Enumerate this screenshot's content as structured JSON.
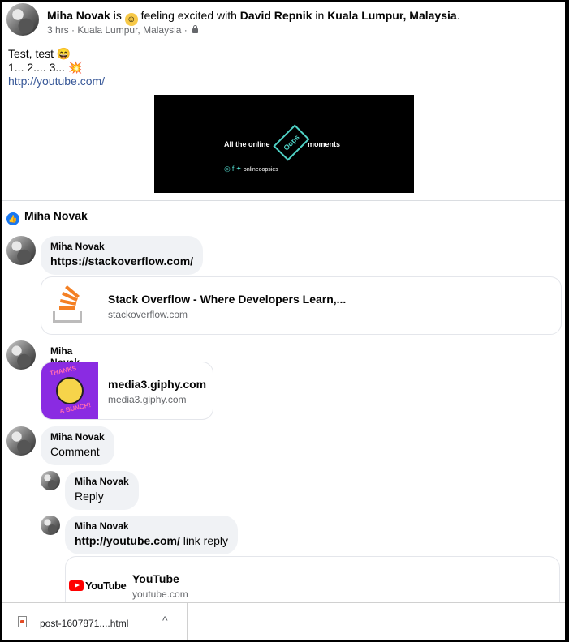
{
  "post": {
    "author": "Miha Novak",
    "is_text": "is",
    "feeling_emoji": "☺",
    "feeling_text": "feeling excited with",
    "tagged": "David Repnik",
    "in_text": "in",
    "location": "Kuala Lumpur, Malaysia",
    "period": ".",
    "time": "3 hrs",
    "meta_location": "Kuala Lumpur, Malaysia",
    "privacy_icon": "lock-icon",
    "text_line1": "Test, test 😄",
    "text_line2_prefix": "1... 2.... 3...",
    "text_line2_emoji": "💥",
    "link": "http://youtube.com/",
    "video": {
      "text_left": "All the online",
      "badge": "Oops",
      "text_right": "moments",
      "social_handle": "onlineoopsies"
    }
  },
  "reaction": {
    "icon": "like-icon",
    "name": "Miha Novak"
  },
  "comments": [
    {
      "author": "Miha Novak",
      "text": "https://stackoverflow.com/",
      "card": {
        "title": "Stack Overflow - Where Developers Learn,...",
        "domain": "stackoverflow.com",
        "icon": "stackoverflow-logo"
      }
    },
    {
      "author": "Miha Novak",
      "card": {
        "title": "media3.giphy.com",
        "domain": "media3.giphy.com",
        "thumb_top": "THANKS",
        "thumb_bottom": "A BUNCH!"
      }
    },
    {
      "author": "Miha Novak",
      "text": "Comment",
      "replies": [
        {
          "author": "Miha Novak",
          "text": "Reply"
        },
        {
          "author": "Miha Novak",
          "text_link": "http://youtube.com/",
          "text_rest": " link reply",
          "card": {
            "title": "YouTube",
            "domain": "youtube.com",
            "logo_text": "YouTube"
          }
        }
      ]
    }
  ],
  "downloads": {
    "file_name": "post-1607871....html",
    "chevron": "^"
  }
}
